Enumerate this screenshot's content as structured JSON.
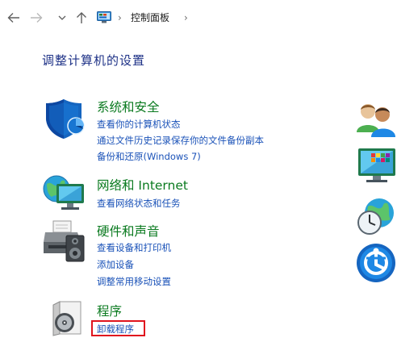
{
  "nav": {
    "back_icon": "back-arrow-icon",
    "forward_icon": "forward-arrow-icon",
    "dropdown_icon": "chevron-down-icon",
    "up_icon": "up-arrow-icon",
    "breadcrumb": {
      "location_icon": "control-panel-icon",
      "separator": "›",
      "item": "控制面板"
    }
  },
  "heading": "调整计算机的设置",
  "categories": [
    {
      "icon": "shield-icon",
      "title": "系统和安全",
      "links": [
        "查看你的计算机状态",
        "通过文件历史记录保存你的文件备份副本",
        "备份和还原(Windows 7)"
      ]
    },
    {
      "icon": "network-globe-icon",
      "title": "网络和 Internet",
      "links": [
        "查看网络状态和任务"
      ]
    },
    {
      "icon": "printer-speaker-icon",
      "title": "硬件和声音",
      "links": [
        "查看设备和打印机",
        "添加设备",
        "调整常用移动设置"
      ]
    },
    {
      "icon": "programs-disc-icon",
      "title": "程序",
      "links": [
        "卸载程序"
      ]
    }
  ],
  "right_column_icons": [
    "user-accounts-icon",
    "appearance-monitor-icon",
    "clock-region-icon",
    "ease-of-access-icon"
  ],
  "colors": {
    "heading": "#1e3287",
    "category_title": "#0a7a1f",
    "link": "#1a52b8",
    "highlight": "#e0141e"
  }
}
